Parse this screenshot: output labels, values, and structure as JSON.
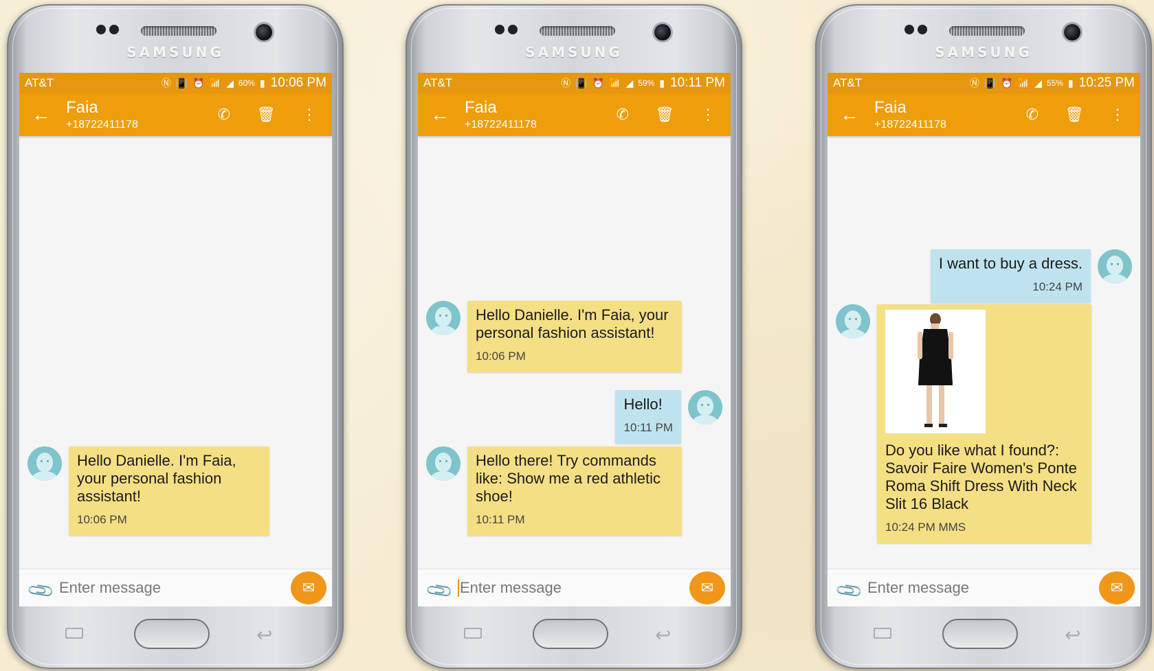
{
  "brand": "SAMSUNG",
  "accent": "#ee9d0b",
  "phones": [
    {
      "status": {
        "carrier": "AT&T",
        "battery": "60%",
        "time": "10:06 PM"
      },
      "header": {
        "back_icon": "arrow-left-icon",
        "name": "Faia",
        "number": "+18722411178"
      },
      "messages": [
        {
          "text": "Hello Danielle. I'm Faia, your personal fashion assistant!",
          "time": "10:06 PM"
        }
      ],
      "input": {
        "placeholder": "Enter message"
      }
    },
    {
      "status": {
        "carrier": "AT&T",
        "battery": "59%",
        "time": "10:11 PM"
      },
      "header": {
        "name": "Faia",
        "number": "+18722411178"
      },
      "messages": [
        {
          "text": "Hello Danielle. I'm Faia, your personal fashion assistant!",
          "time": "10:06 PM"
        },
        {
          "text": "Hello!",
          "time": "10:11 PM"
        },
        {
          "text": "Hello there! Try commands like: Show me a red athletic shoe!",
          "time": "10:11 PM"
        }
      ],
      "input": {
        "placeholder": "Enter message"
      }
    },
    {
      "status": {
        "carrier": "AT&T",
        "battery": "55%",
        "time": "10:25 PM"
      },
      "header": {
        "name": "Faia",
        "number": "+18722411178"
      },
      "messages": [
        {
          "text": "I want to buy a dress.",
          "time": "10:24 PM"
        },
        {
          "text": "Do you like what I found?: Savoir Faire Women's Ponte Roma Shift Dress With Neck Slit 16 Black",
          "time": "10:24 PM MMS"
        }
      ],
      "input": {
        "placeholder": "Enter message"
      }
    }
  ]
}
